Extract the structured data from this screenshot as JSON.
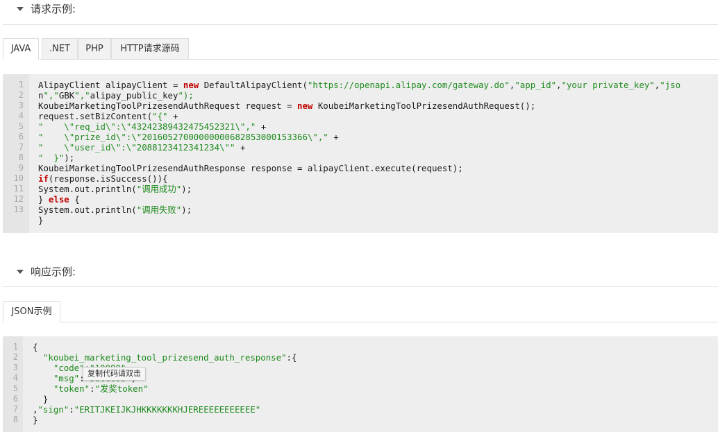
{
  "request_section": {
    "title": "请求示例:"
  },
  "request_tabs": [
    {
      "label": "JAVA",
      "active": true
    },
    {
      "label": ".NET",
      "active": false
    },
    {
      "label": "PHP",
      "active": false
    },
    {
      "label": "HTTP请求源码",
      "active": false
    }
  ],
  "java_code": [
    "AlipayClient alipayClient = new DefaultAlipayClient(\"https://openapi.alipay.com/gateway.do\",\"app_id\",\"your private_key\",\"jso",
    "n\",\"GBK\",\"alipay_public_key\");",
    "KoubeiMarketingToolPrizesendAuthRequest request = new KoubeiMarketingToolPrizesendAuthRequest();",
    "request.setBizContent(\"{\" +",
    "\"    \\\"req_id\\\":\\\"43242389432475452321\\\",\" +",
    "\"    \\\"prize_id\\\":\\\"20160527000000000682853000153366\\\",\" +",
    "\"    \\\"user_id\\\":\\\"2088123412341234\\\"\" +",
    "\"  }\");",
    "KoubeiMarketingToolPrizesendAuthResponse response = alipayClient.execute(request);",
    "if(response.isSuccess()){",
    "System.out.println(\"调用成功\");",
    "} else {",
    "System.out.println(\"调用失败\");",
    "}"
  ],
  "java_line_numbers": [
    "1",
    "2",
    "3",
    "4",
    "5",
    "6",
    "7",
    "8",
    "9",
    "10",
    "11",
    "12",
    "13"
  ],
  "response_section": {
    "title": "响应示例:"
  },
  "response_tabs": [
    {
      "label": "JSON示例",
      "active": true
    }
  ],
  "json_code": [
    "{",
    "  \"koubei_marketing_tool_prizesend_auth_response\":{",
    "    \"code\":\"10000\",",
    "    \"msg\":\"Success\",",
    "    \"token\":\"发奖token\"",
    "  }",
    ",\"sign\":\"ERITJKEIJKJHKKKKKKKHJEREEEEEEEEEEE\"",
    "}"
  ],
  "json_line_numbers": [
    "1",
    "2",
    "3",
    "4",
    "5",
    "6",
    "7",
    "8"
  ],
  "copy_tooltip": "复制代码请双击",
  "colors": {
    "keyword": "#c00000",
    "string": "#1e8a1e",
    "code_bg": "#eeeeee"
  }
}
